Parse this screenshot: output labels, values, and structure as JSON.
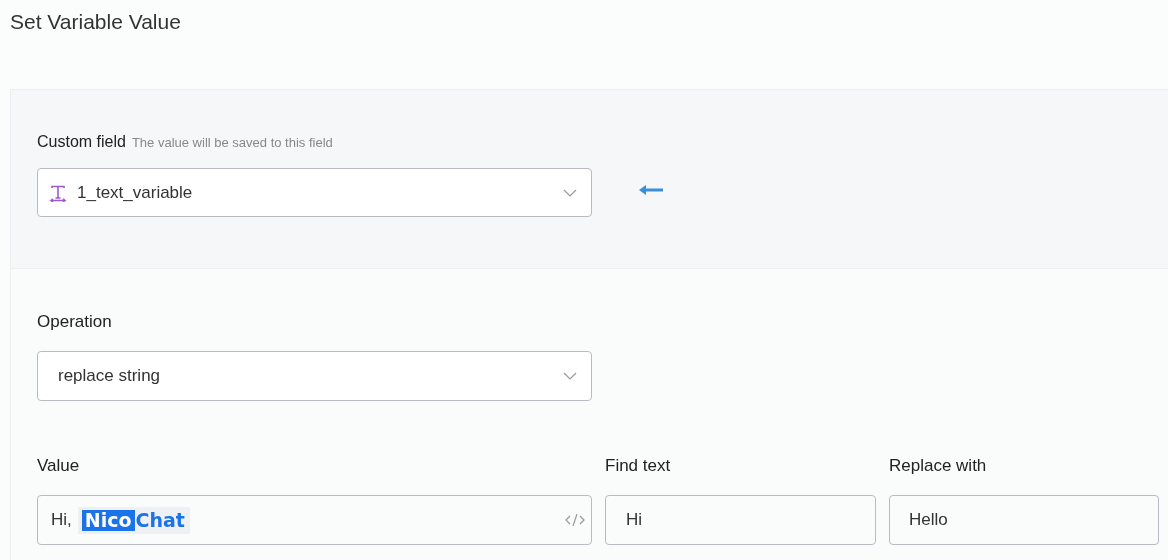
{
  "title": "Set Variable Value",
  "custom_field": {
    "label": "Custom field",
    "hint": "The value will be saved to this field",
    "value": "1_text_variable"
  },
  "operation": {
    "label": "Operation",
    "value": "replace string"
  },
  "value": {
    "label": "Value",
    "text": "Hi,",
    "tag": [
      "Nico",
      "Chat"
    ]
  },
  "find_text": {
    "label": "Find text",
    "value": "Hi"
  },
  "replace_with": {
    "label": "Replace with",
    "value": "Hello"
  }
}
